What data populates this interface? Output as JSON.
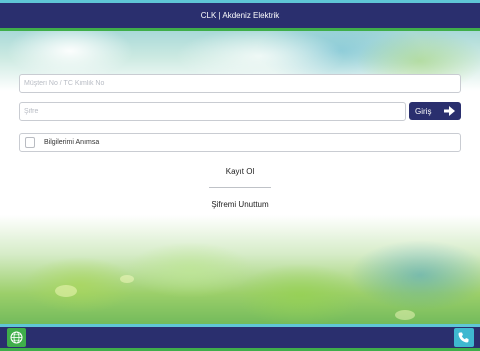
{
  "header": {
    "title": "CLK | Akdeniz Elektrik"
  },
  "login": {
    "customer_placeholder": "Müşteri No / TC Kimlik No",
    "password_placeholder": "Şifre",
    "login_button": "Giriş",
    "remember_label": "Bilgilerimi Anımsa",
    "remember_checked": false
  },
  "links": {
    "register": "Kayıt Ol",
    "forgot_password": "Şifremi Unuttum"
  },
  "footer": {
    "left_icon": "globe-icon",
    "right_icon": "phone-icon"
  },
  "colors": {
    "primary": "#2a2f6e",
    "accent_green": "#3fae4a",
    "accent_cyan": "#5fc6d6"
  }
}
